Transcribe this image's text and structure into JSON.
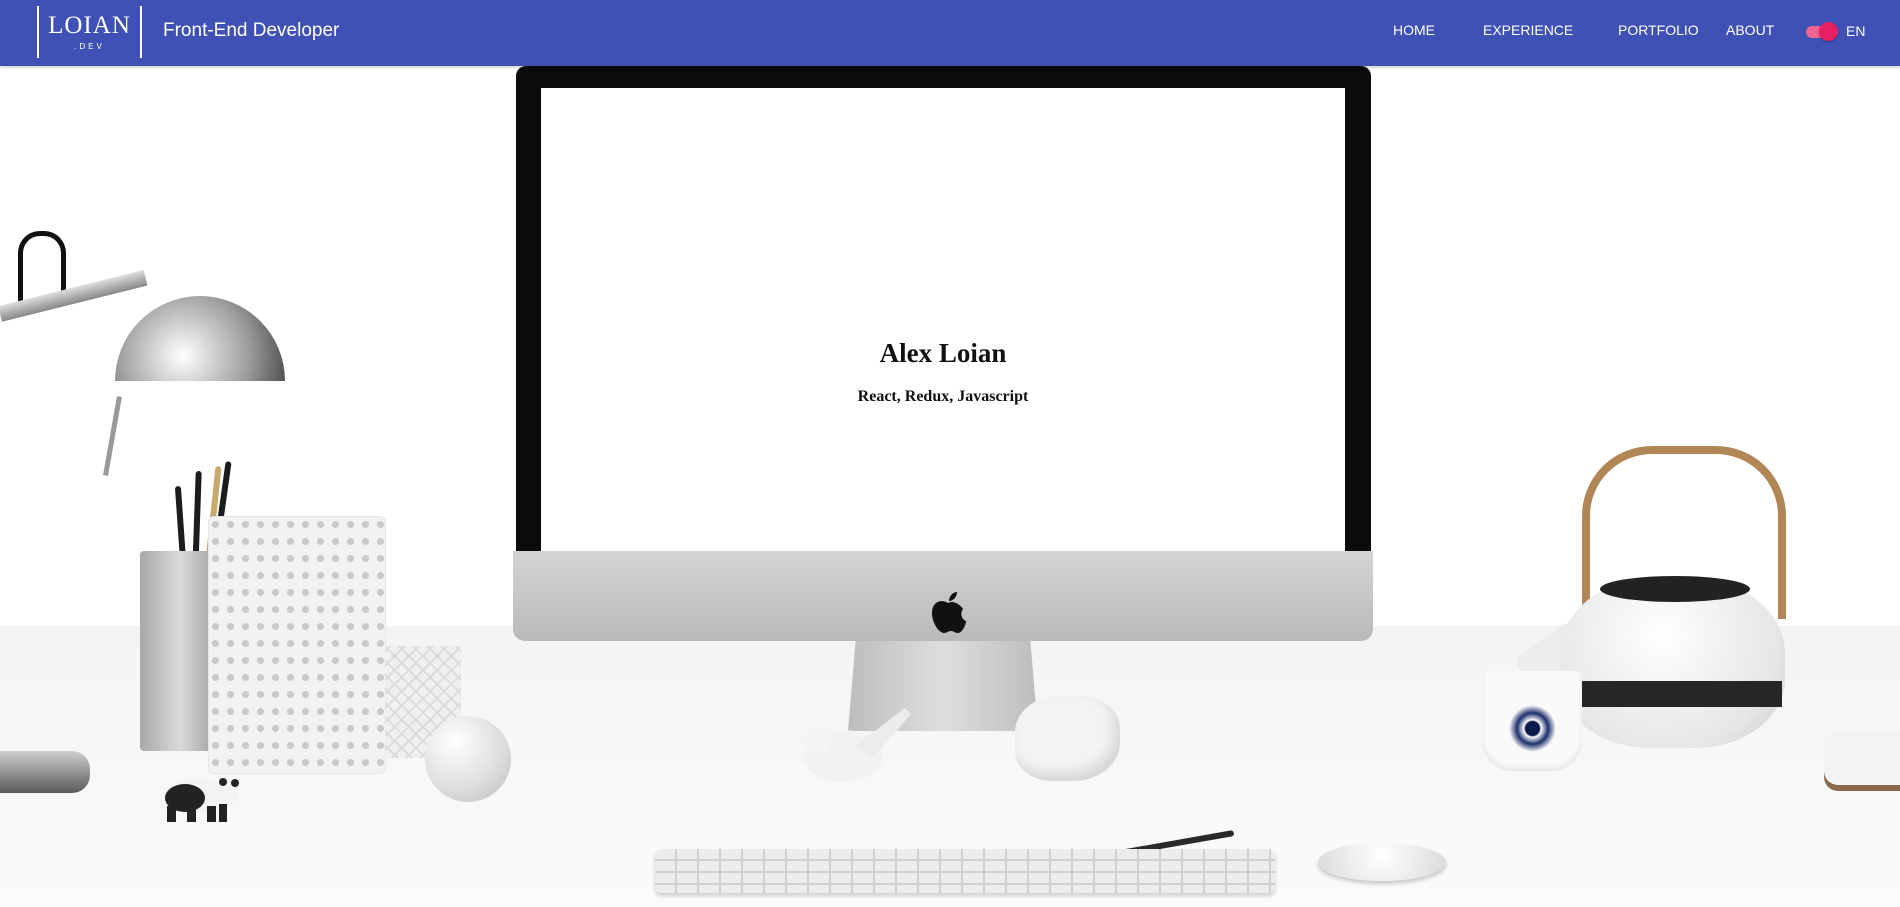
{
  "nav": {
    "logo_text": "LOIAN",
    "logo_sub": ".DEV",
    "title": "Front-End Developer",
    "links": [
      {
        "label": "HOME"
      },
      {
        "label": "EXPERIENCE"
      },
      {
        "label": "PORTFOLIO"
      },
      {
        "label": "ABOUT"
      }
    ],
    "language": {
      "label": "EN",
      "enabled": true
    }
  },
  "hero": {
    "name": "Alex Loian",
    "skills": "React, Redux, Javascript"
  },
  "colors": {
    "navbar": "#3f51b5",
    "toggle_accent": "#e91e63",
    "nav_text": "#ffffff",
    "hero_text": "#111111"
  },
  "icons": {
    "apple": "apple-icon"
  }
}
